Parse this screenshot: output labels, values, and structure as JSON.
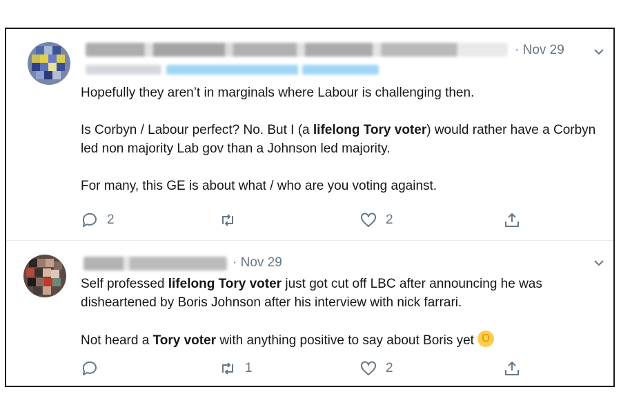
{
  "tweets": [
    {
      "date": "· Nov 29",
      "paragraphs": [
        [
          "Hopefully they aren’t in marginals where Labour is challenging then."
        ],
        [
          "Is Corbyn / Labour perfect? No. But I (a ",
          {
            "b": "lifelong Tory voter"
          },
          ") would rather have a Corbyn led non majority Lab gov than a Johnson led majority."
        ],
        [
          "For many, this GE is about what / who are you voting against."
        ]
      ],
      "replies": "2",
      "retweets": "",
      "likes": "2"
    },
    {
      "date": "· Nov 29",
      "paragraphs": [
        [
          "Self professed ",
          {
            "b": "lifelong Tory voter"
          },
          " just got cut off LBC after announcing he was disheartened by Boris Johnson after his interview with nick farrari."
        ],
        [
          "Not heard a ",
          {
            "b": "Tory voter"
          },
          " with anything positive to say about Boris yet ",
          {
            "emoji": "raised-fist-emoji"
          }
        ]
      ],
      "replies": "",
      "retweets": "1",
      "likes": "2"
    }
  ],
  "icons": {
    "reply": "reply-icon",
    "retweet": "retweet-icon",
    "like": "heart-icon",
    "share": "share-icon",
    "more": "chevron-down-icon"
  },
  "colors": {
    "text": "#14171a",
    "muted": "#657786",
    "link_blur": "#1da1f2",
    "divider": "#e6ecf0"
  }
}
